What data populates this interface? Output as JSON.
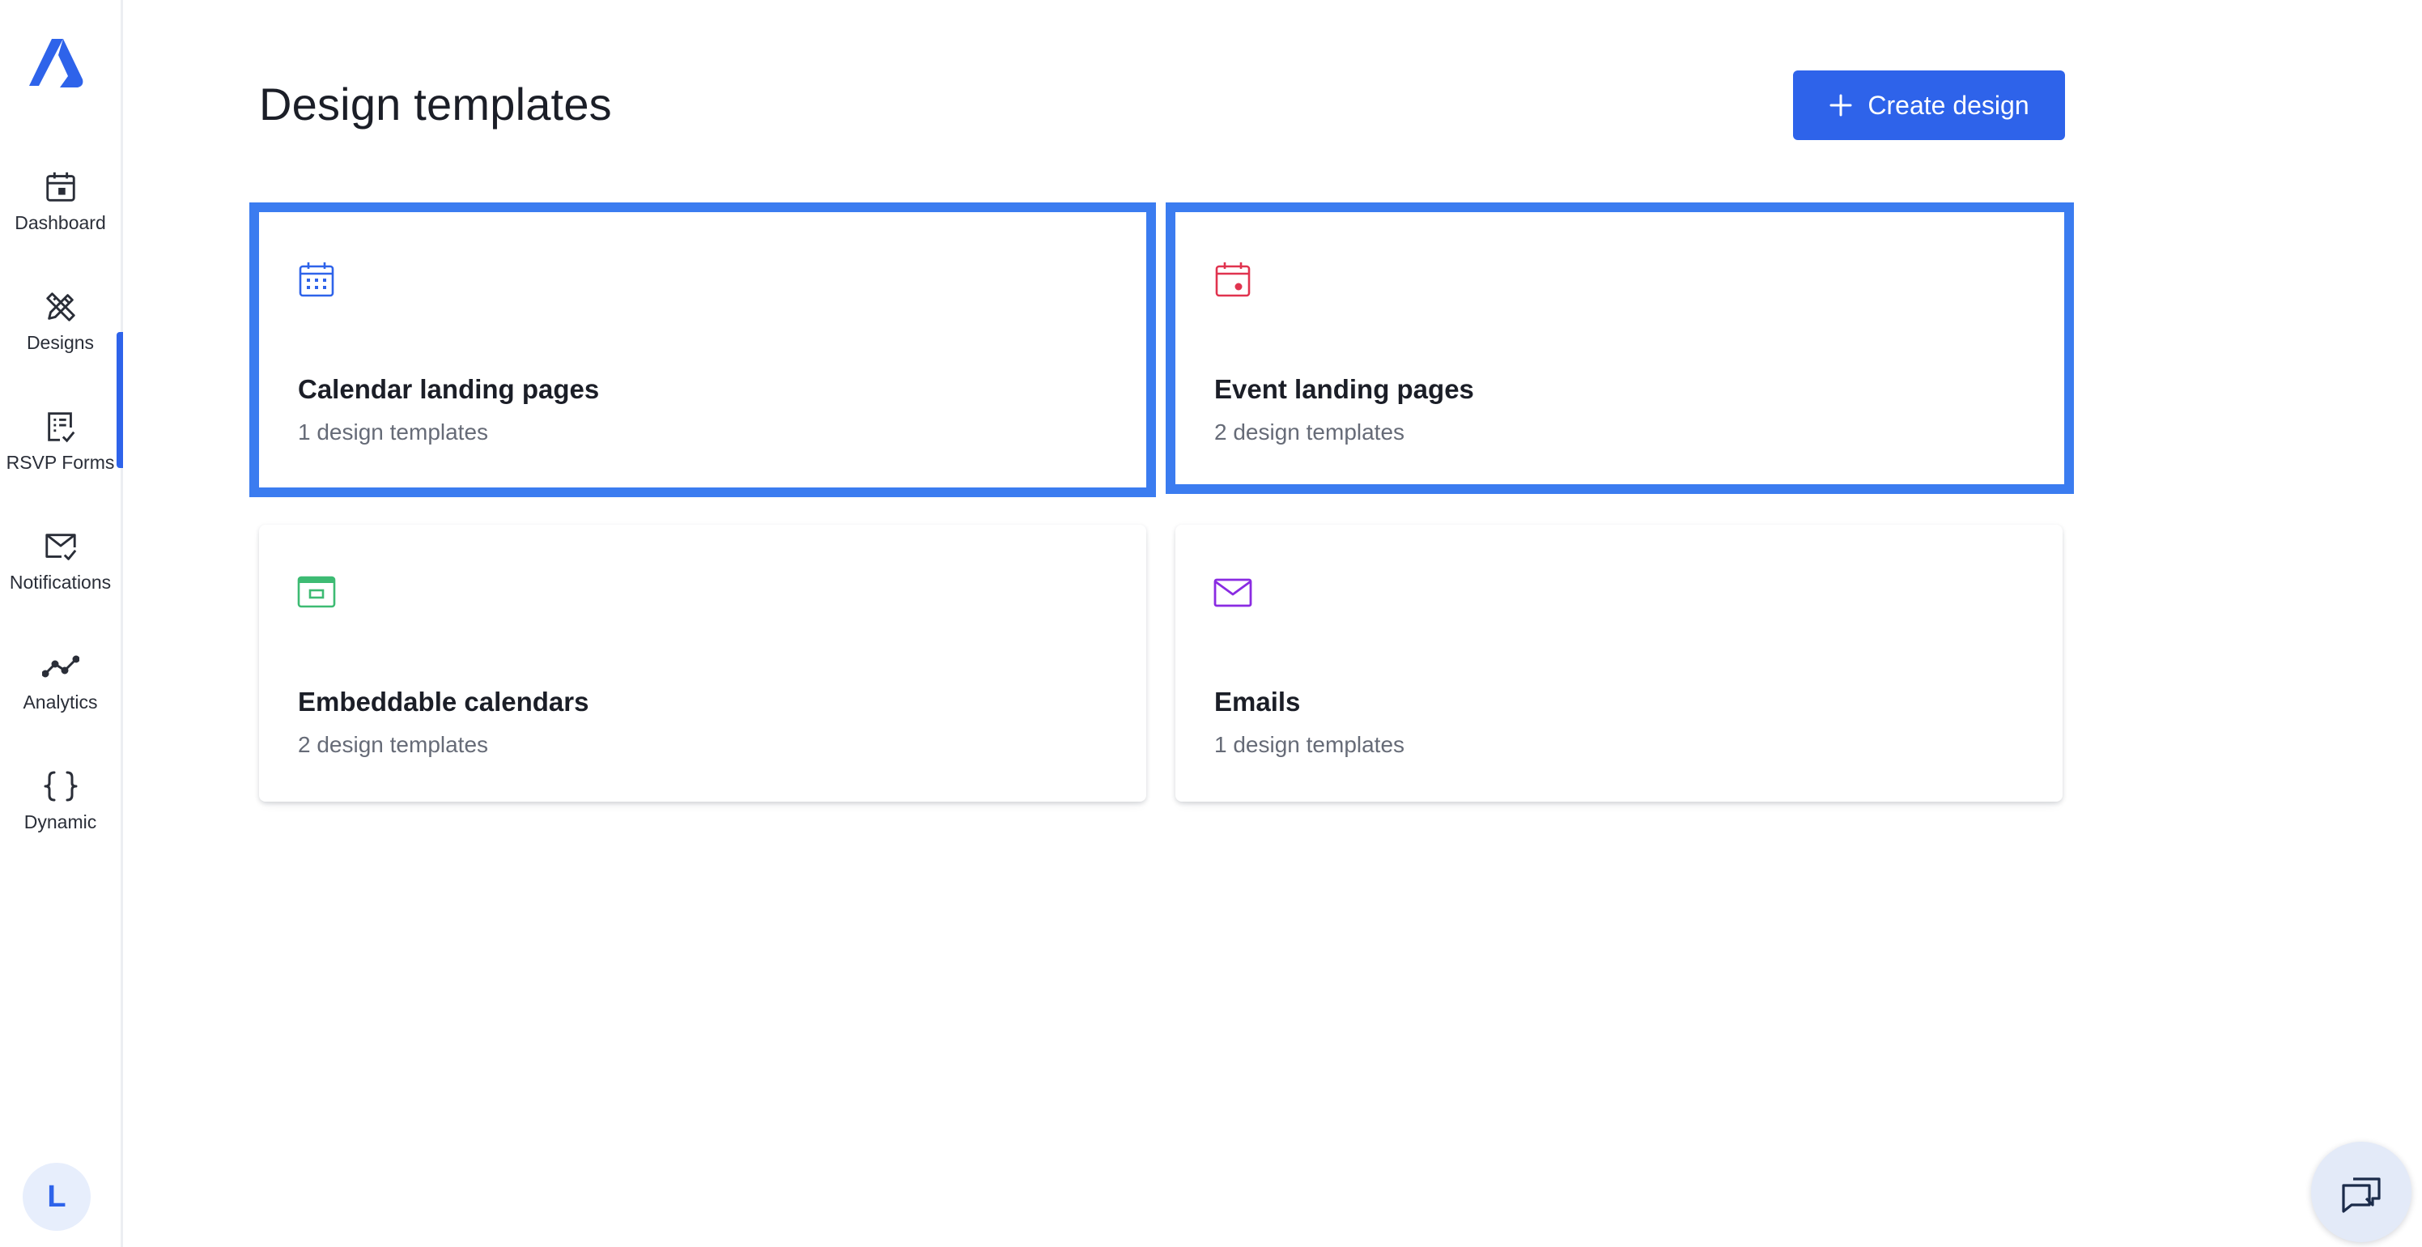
{
  "colors": {
    "accent": "#2e63ea",
    "selection_outline": "#3b7cf0",
    "calendar_icon": "#2e63ea",
    "event_icon": "#e0334f",
    "embed_icon": "#3dbb73",
    "email_icon": "#8a2be2"
  },
  "sidebar": {
    "logo": "brand-logo",
    "items": [
      {
        "label": "Dashboard",
        "icon": "calendar-dashboard-icon"
      },
      {
        "label": "Designs",
        "icon": "design-tools-icon",
        "active": true
      },
      {
        "label": "RSVP Forms",
        "icon": "form-checklist-icon"
      },
      {
        "label": "Notifications",
        "icon": "mail-check-icon"
      },
      {
        "label": "Analytics",
        "icon": "line-chart-icon"
      },
      {
        "label": "Dynamic",
        "icon": "curly-braces-icon"
      }
    ],
    "avatar_initial": "L"
  },
  "header": {
    "title": "Design templates",
    "create_label": "Create design"
  },
  "cards": [
    {
      "title": "Calendar landing pages",
      "subtitle": "1 design templates",
      "icon": "calendar-grid-icon",
      "selected": true
    },
    {
      "title": "Event landing pages",
      "subtitle": "2 design templates",
      "icon": "event-calendar-icon",
      "selected": true
    },
    {
      "title": "Embeddable calendars",
      "subtitle": "2 design templates",
      "icon": "embed-window-icon",
      "selected": false
    },
    {
      "title": "Emails",
      "subtitle": "1 design templates",
      "icon": "envelope-icon",
      "selected": false
    }
  ],
  "chat": {
    "icon": "chat-bubbles-icon"
  }
}
